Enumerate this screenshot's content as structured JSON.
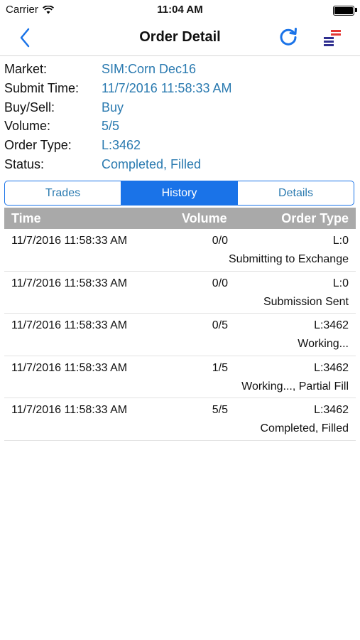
{
  "status_bar": {
    "carrier": "Carrier",
    "time": "11:04 AM",
    "battery_level": 1.0
  },
  "nav": {
    "title": "Order Detail",
    "back_icon": "chevron-left-icon",
    "refresh_icon": "refresh-icon",
    "menu_icon": "menu-icon"
  },
  "order": {
    "market_label": "Market:",
    "market_value": "SIM:Corn Dec16",
    "submit_time_label": "Submit Time:",
    "submit_time_value": "11/7/2016 11:58:33 AM",
    "buy_sell_label": "Buy/Sell:",
    "buy_sell_value": "Buy",
    "volume_label": "Volume:",
    "volume_value": "5/5",
    "order_type_label": "Order Type:",
    "order_type_value": "L:3462",
    "status_label": "Status:",
    "status_value": "Completed, Filled"
  },
  "tabs": [
    {
      "label": "Trades",
      "active": false
    },
    {
      "label": "History",
      "active": true
    },
    {
      "label": "Details",
      "active": false
    }
  ],
  "table": {
    "headers": {
      "time": "Time",
      "volume": "Volume",
      "order_type": "Order Type"
    },
    "rows": [
      {
        "time": "11/7/2016 11:58:33 AM",
        "volume": "0/0",
        "order_type": "L:0",
        "status": "Submitting to Exchange"
      },
      {
        "time": "11/7/2016 11:58:33 AM",
        "volume": "0/0",
        "order_type": "L:0",
        "status": "Submission Sent"
      },
      {
        "time": "11/7/2016 11:58:33 AM",
        "volume": "0/5",
        "order_type": "L:3462",
        "status": "Working..."
      },
      {
        "time": "11/7/2016 11:58:33 AM",
        "volume": "1/5",
        "order_type": "L:3462",
        "status": "Working..., Partial Fill"
      },
      {
        "time": "11/7/2016 11:58:33 AM",
        "volume": "5/5",
        "order_type": "L:3462",
        "status": "Completed, Filled"
      }
    ]
  },
  "colors": {
    "accent": "#1a73e8",
    "value_text": "#2a7ab0",
    "header_bg": "#a9a9a9",
    "menu_red": "#e53935",
    "menu_navy": "#2f2f8f"
  }
}
